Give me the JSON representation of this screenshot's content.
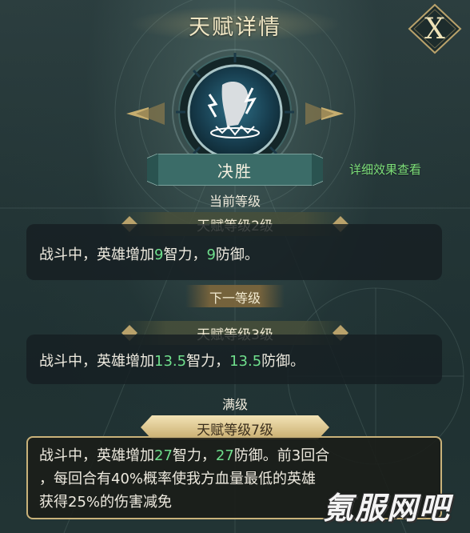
{
  "title": "天赋详情",
  "close_label": "X",
  "talent_name": "决胜",
  "details_link": "详细效果查看",
  "current": {
    "section_label": "当前等级",
    "level_label": "天赋等级2级",
    "desc_prefix": "战斗中，英雄增加",
    "value1": "9",
    "mid1": "智力，",
    "value2": "9",
    "suffix": "防御。"
  },
  "next": {
    "section_label": "下一等级",
    "level_label": "天赋等级3级",
    "desc_prefix": "战斗中，英雄增加",
    "value1": "13.5",
    "mid1": "智力，",
    "value2": "13.5",
    "suffix": "防御。"
  },
  "max": {
    "section_label": "满级",
    "level_label": "天赋等级7级",
    "desc_prefix": "战斗中，英雄增加",
    "value1": "27",
    "mid1": "智力，",
    "value2": "27",
    "suffix": "防御。前3回合",
    "line2": "，每回合有40%概率使我方血量最低的英雄",
    "line3": "获得25%的伤害减免"
  },
  "watermark": "氪服网吧",
  "colors": {
    "highlight": "#6fdf8c",
    "gold": "#c9b27a",
    "link": "#7ee07a"
  }
}
